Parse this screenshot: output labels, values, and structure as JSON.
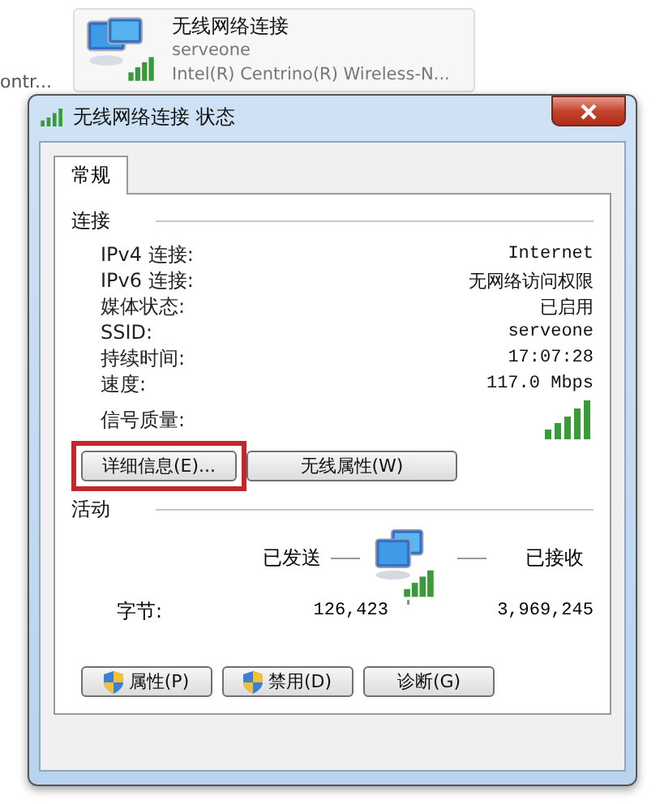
{
  "background_item": {
    "title": "无线网络连接",
    "subtitle": "serveone",
    "detail": "Intel(R) Centrino(R) Wireless-N..."
  },
  "left_label": "ontr...",
  "dialog": {
    "title": "无线网络连接 状态",
    "tabs": [
      {
        "label": "常规",
        "selected": true
      }
    ],
    "connection": {
      "heading": "连接",
      "rows": [
        {
          "label": "IPv4 连接:",
          "value": "Internet"
        },
        {
          "label": "IPv6 连接:",
          "value": "无网络访问权限"
        },
        {
          "label": "媒体状态:",
          "value": "已启用"
        },
        {
          "label": "SSID:",
          "value": "serveone"
        },
        {
          "label": "持续时间:",
          "value": "17:07:28"
        },
        {
          "label": "速度:",
          "value": "117.0 Mbps"
        }
      ],
      "signal_label": "信号质量:",
      "buttons": [
        {
          "label": "详细信息(E)...",
          "highlighted": true
        },
        {
          "label": "无线属性(W)",
          "highlighted": false
        }
      ]
    },
    "activity": {
      "heading": "活动",
      "sent_label": "已发送",
      "received_label": "已接收",
      "bytes_label": "字节:",
      "sent": "126,423",
      "received": "3,969,245"
    },
    "action_buttons": [
      {
        "label": "属性(P)",
        "shield": true
      },
      {
        "label": "禁用(D)",
        "shield": true
      },
      {
        "label": "诊断(G)",
        "shield": false
      }
    ]
  }
}
